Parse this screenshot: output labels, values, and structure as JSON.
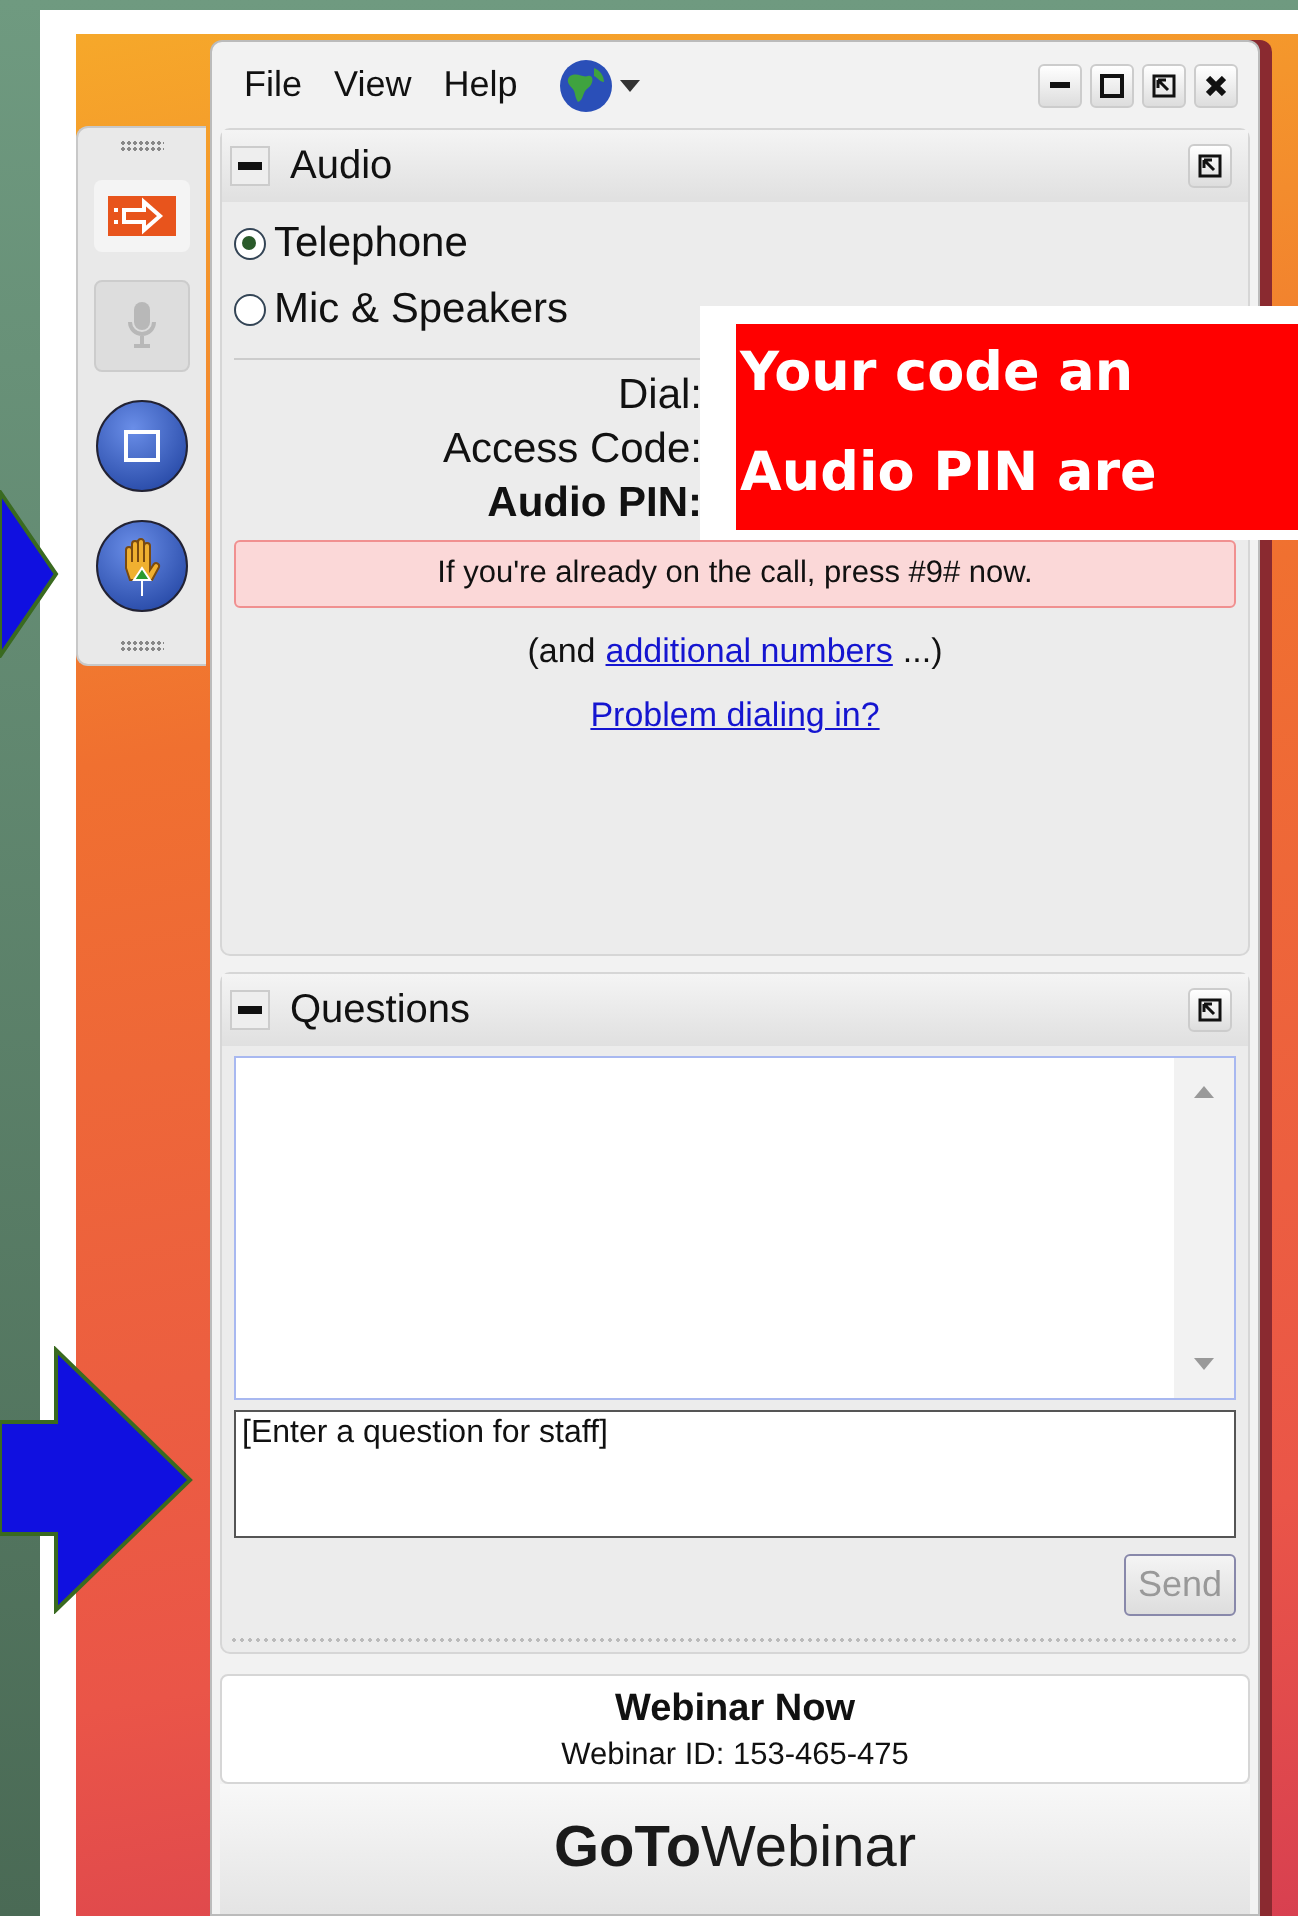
{
  "menu": [
    {
      "label": "File"
    },
    {
      "label": "View"
    },
    {
      "label": "Help"
    }
  ],
  "toolbar": [
    {
      "kind": "arrow",
      "disabled": false
    },
    {
      "kind": "mic",
      "disabled": true
    },
    {
      "kind": "screen",
      "disabled": false
    },
    {
      "kind": "hand",
      "disabled": false
    }
  ],
  "audio": {
    "title": "Audio",
    "options": [
      {
        "label": "Telephone",
        "selected": true
      },
      {
        "label": "Mic & Speakers",
        "selected": false
      }
    ],
    "fields": [
      {
        "label": "Dial:",
        "bold": false
      },
      {
        "label": "Access Code:",
        "bold": false
      },
      {
        "label": "Audio PIN:",
        "bold": true
      }
    ],
    "notice": "If you're already on the call, press #9# now.",
    "additional": {
      "before": "(and",
      "link": "additional numbers",
      "after": "...)"
    },
    "help_link": "Problem dialing in?"
  },
  "questions": {
    "title": "Questions",
    "placeholder": "[Enter a question for staff]",
    "send": {
      "label": "Send",
      "disabled": true
    }
  },
  "footer": {
    "title": "Webinar Now",
    "webinar_id": "Webinar ID: 153-465-475",
    "logo": "**GoTo**Webinar"
  },
  "callout": {
    "lines": [
      "Your code an",
      "Audio PIN are"
    ]
  }
}
